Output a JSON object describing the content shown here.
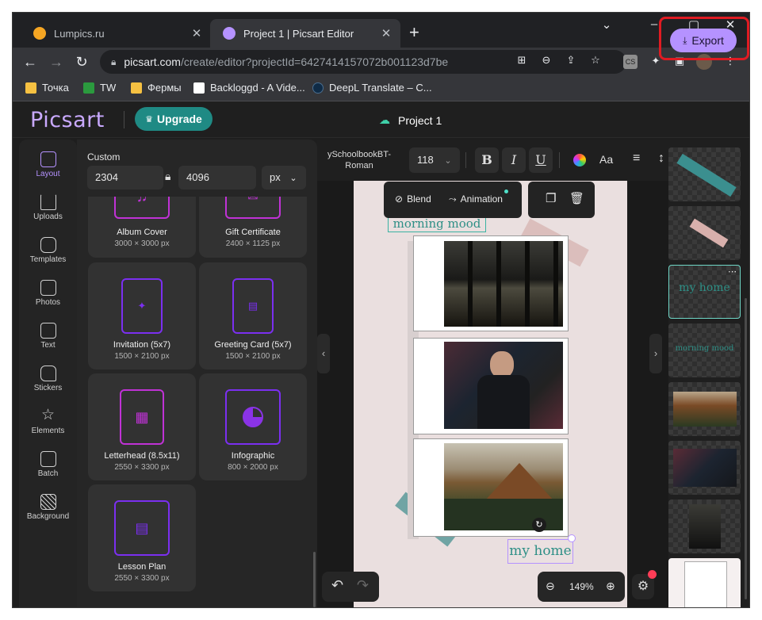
{
  "browser": {
    "tabs": [
      {
        "label": "Lumpics.ru",
        "color": "#f6a623"
      },
      {
        "label": "Project 1 | Picsart Editor",
        "color": "#b592ff"
      }
    ],
    "new_tab": "+",
    "window_controls": {
      "minimize": "–",
      "maximize": "▢",
      "close": "✕",
      "chevron": "⌄"
    },
    "address": {
      "host": "picsart.com",
      "path": "/create/editor?projectId=6427414157072b001123d7be"
    },
    "bookmarks": [
      {
        "label": "Точка",
        "icon": "folder-icon",
        "color": "#f6c142"
      },
      {
        "label": "TW",
        "icon": "tw-icon",
        "color": "#2b9a3e"
      },
      {
        "label": "Фермы",
        "icon": "folder-icon",
        "color": "#f6c142"
      },
      {
        "label": "Backloggd - A Vide...",
        "icon": "backloggd-icon",
        "color": "#ffffff"
      },
      {
        "label": "DeepL Translate – C...",
        "icon": "deepl-icon",
        "color": "#0f2b46"
      }
    ],
    "ext_badge": "CS"
  },
  "header": {
    "logo": "Picsart",
    "upgrade": "Upgrade",
    "project_title": "Project 1",
    "export": "Export"
  },
  "rail": [
    {
      "label": "Layout",
      "active": true
    },
    {
      "label": "Uploads"
    },
    {
      "label": "Templates"
    },
    {
      "label": "Photos"
    },
    {
      "label": "Text"
    },
    {
      "label": "Stickers"
    },
    {
      "label": "Elements"
    },
    {
      "label": "Batch"
    },
    {
      "label": "Background"
    }
  ],
  "panel": {
    "custom_label": "Custom",
    "width": "2304",
    "height": "4096",
    "unit": "px",
    "cards": [
      {
        "name": "Album Cover",
        "dims": "3000 × 3000 px"
      },
      {
        "name": "Gift Certificate",
        "dims": "2400 × 1125 px"
      },
      {
        "name": "Invitation (5x7)",
        "dims": "1500 × 2100 px"
      },
      {
        "name": "Greeting Card (5x7)",
        "dims": "1500 × 2100 px"
      },
      {
        "name": "Letterhead (8.5x11)",
        "dims": "2550 × 3300 px"
      },
      {
        "name": "Infographic",
        "dims": "800 × 2000 px"
      },
      {
        "name": "Lesson Plan",
        "dims": "2550 × 3300 px"
      }
    ]
  },
  "textbar": {
    "font_line1": "ySchoolbookBT-",
    "font_line2": "Roman",
    "size": "118",
    "bold": "B",
    "italic": "I",
    "underline": "U",
    "case": "Aa"
  },
  "context": {
    "blend": "Blend",
    "animation": "Animation"
  },
  "canvas": {
    "mood_text": "morning mood",
    "home_text": "my home"
  },
  "zoom": {
    "level": "149%"
  },
  "layers": {
    "home_text": "my home",
    "mood_text": "morning mood"
  }
}
